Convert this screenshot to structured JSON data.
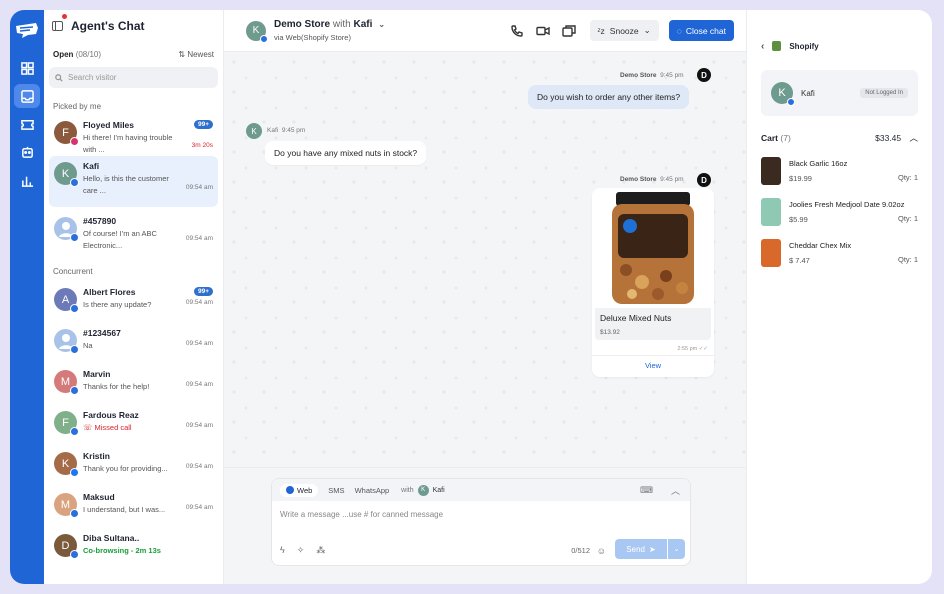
{
  "header": {
    "app_title": "Agent's Chat"
  },
  "list": {
    "open_label": "Open",
    "open_count": "(08/10)",
    "sort_label": "Newest",
    "search_placeholder": "Search visitor",
    "section_picked": "Picked by me",
    "section_concurrent": "Concurrent",
    "picked": [
      {
        "name": "Floyed Miles",
        "msg": "Hi there! I'm having trouble with ...",
        "time": "3m 20s",
        "badge": "99+",
        "avatar_color": "#8b5a3c",
        "initial": "F",
        "channel": "instagram"
      },
      {
        "name": "Kafi",
        "msg": "Hello, is this the customer care ...",
        "time": "09:54 am",
        "badge": "",
        "avatar_color": "#6f9b8f",
        "initial": "K",
        "channel": "web"
      },
      {
        "name": "#457890",
        "msg": "Of course! I'm an ABC Electronic...",
        "time": "09:54 am",
        "badge": "",
        "avatar_color": "#a9c3e8",
        "initial": "",
        "channel": "web"
      }
    ],
    "concurrent": [
      {
        "name": "Albert Flores",
        "msg": "Is there any update?",
        "time": "09:54 am",
        "badge": "99+",
        "avatar_color": "#6c7ab8",
        "initial": "A",
        "channel": "web"
      },
      {
        "name": "#1234567",
        "msg": "Na",
        "time": "09:54 am",
        "badge": "",
        "avatar_color": "#a9c3e8",
        "initial": "",
        "channel": "web"
      },
      {
        "name": "Marvin",
        "msg": "Thanks for the help!",
        "time": "09:54 am",
        "badge": "",
        "avatar_color": "#d57a7a",
        "initial": "M",
        "channel": "web"
      },
      {
        "name": "Fardous Reaz",
        "msg": "Missed call",
        "time": "09:54 am",
        "badge": "",
        "avatar_color": "#7fb08a",
        "initial": "F",
        "channel": "web"
      },
      {
        "name": "Kristin",
        "msg": "Thank you for providing...",
        "time": "09:54 am",
        "badge": "",
        "avatar_color": "#a56b49",
        "initial": "K",
        "channel": "facebook"
      },
      {
        "name": "Maksud",
        "msg": "I understand, but I was...",
        "time": "09:54 am",
        "badge": "",
        "avatar_color": "#d9a37f",
        "initial": "M",
        "channel": "web"
      },
      {
        "name": "Diba Sultana..",
        "msg": "Co-browsing - 2m 13s",
        "time": "",
        "badge": "",
        "avatar_color": "#7a5a3a",
        "initial": "D",
        "channel": "web"
      }
    ]
  },
  "chat": {
    "store": "Demo Store",
    "with_word": "with",
    "visitor": "Kafi",
    "via": "via Web(Shopify Store)",
    "snooze_label": "Snooze",
    "close_label": "Close chat",
    "messages": {
      "m1_sender": "Demo Store",
      "m1_time": "9:45 pm",
      "m1_text": "Do you wish to order any other items?",
      "m2_sender": "Kafi",
      "m2_time": "9:45 pm",
      "m2_text": "Do you have any mixed nuts in stock?",
      "m3_sender": "Demo Store",
      "m3_time": "9:45 pm",
      "product_name": "Deluxe Mixed Nuts",
      "product_price": "$13.92",
      "product_time": "2:55 pm",
      "view_label": "View",
      "agent_initial": "D",
      "visitor_initial": "K"
    },
    "composer": {
      "tab_web": "Web",
      "tab_sms": "SMS",
      "tab_whatsapp": "WhatsApp",
      "with_label": "with",
      "with_name": "Kafi",
      "placeholder": "Write a message ...use # for canned message",
      "count": "0/512",
      "send_label": "Send"
    }
  },
  "side": {
    "store_name": "Shopify",
    "visitor_name": "Kafi",
    "login_status": "Not Logged In",
    "cart_label": "Cart",
    "cart_count": "(7)",
    "cart_total": "$33.45",
    "items": [
      {
        "name": "Black Garlic 16oz",
        "price": "$19.99",
        "qty": "Qty: 1",
        "color": "#3a2a20"
      },
      {
        "name": "Joolies Fresh Medjool Date 9.02oz",
        "price": "$5.99",
        "qty": "Qty: 1",
        "color": "#8fc9b4"
      },
      {
        "name": "Cheddar Chex Mix",
        "price": "$ 7.47",
        "qty": "Qty: 1",
        "color": "#d8692a"
      }
    ]
  }
}
